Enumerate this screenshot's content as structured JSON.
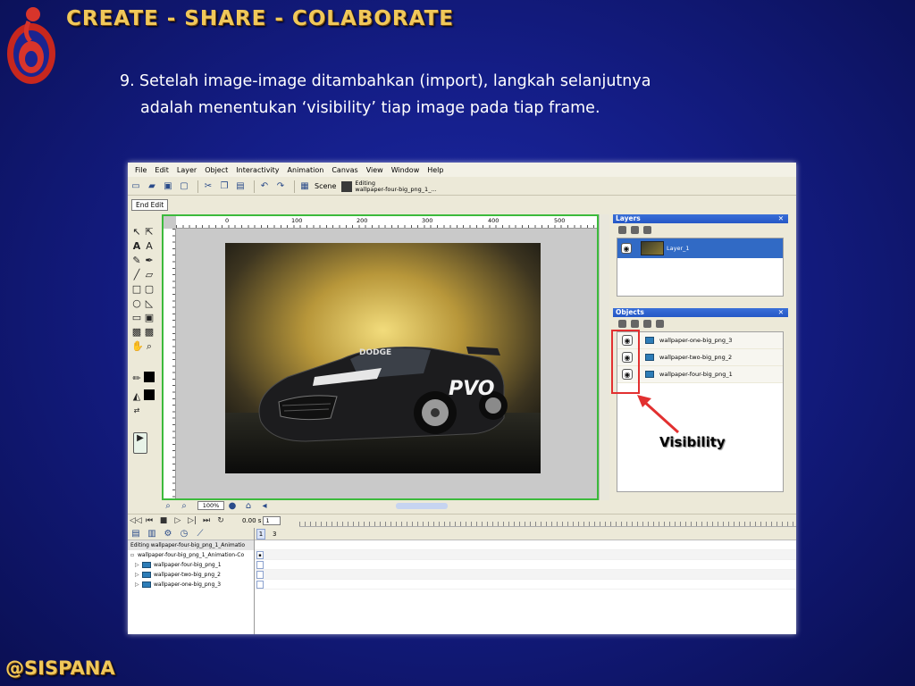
{
  "slide": {
    "title": "CREATE - SHARE - COLABORATE",
    "instruction_number": "9.",
    "instruction_line1": "Setelah image-image ditambahkan (import), langkah selanjutnya",
    "instruction_line2": "adalah menentukan ‘visibility’ tiap image pada tiap frame.",
    "footer": "@SISPANA",
    "accent_color": "#f0c85a"
  },
  "app": {
    "menu": [
      "File",
      "Edit",
      "Layer",
      "Object",
      "Interactivity",
      "Animation",
      "Canvas",
      "View",
      "Window",
      "Help"
    ],
    "toolbar": {
      "scene_label": "Scene",
      "editing_label": "Editing",
      "editing_target": "wallpaper-four-big_png_1_..."
    },
    "end_edit_label": "End Edit",
    "ruler_labels": [
      "0",
      "100",
      "200",
      "300",
      "400",
      "500"
    ],
    "vruler_labels": [
      "0",
      "100",
      "150",
      "200",
      "250",
      "300",
      "350",
      "400",
      "450",
      "500"
    ],
    "zoom": "100%",
    "layers_panel": {
      "title": "Layers",
      "layer_name": "Layer_1"
    },
    "objects_panel": {
      "title": "Objects",
      "items": [
        "wallpaper-one-big_png_3",
        "wallpaper-two-big_png_2",
        "wallpaper-four-big_png_1"
      ]
    },
    "annotation": {
      "label": "Visibility",
      "color": "#e23030"
    },
    "timeline": {
      "time": "0.00 s",
      "frame": "1",
      "frame_numbers": [
        "1",
        "3"
      ],
      "editing_row": "Editing wallpaper-four-big_png_1_Animatio",
      "animation_row": "wallpaper-four-big_png_1_Animation-Co",
      "tracks": [
        "wallpaper-four-big_png_1",
        "wallpaper-two-big_png_2",
        "wallpaper-one-big_png_3"
      ]
    },
    "canvas_image": {
      "car_brand": "DODGE",
      "car_text": "PVO"
    }
  }
}
